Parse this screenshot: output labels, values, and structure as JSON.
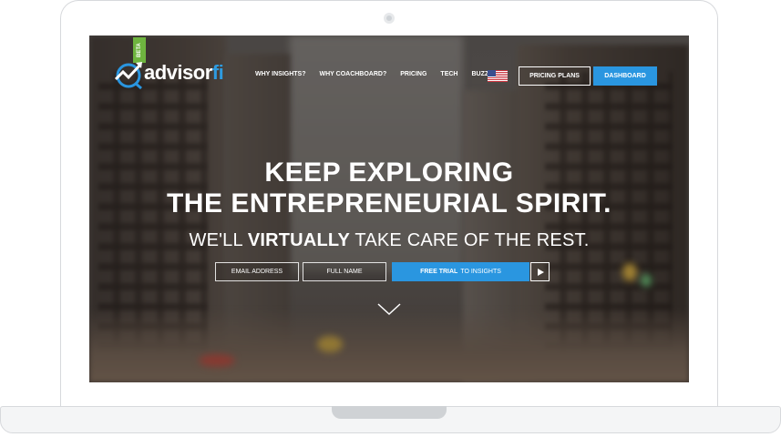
{
  "brand": {
    "name_main": "advisor",
    "name_accent": "fi",
    "badge": "BETA",
    "accent_color": "#2a96e0",
    "badge_color": "#6eb43f"
  },
  "nav": {
    "items": [
      "WHY INSIGHTS?",
      "WHY COACHBOARD?",
      "PRICING",
      "TECH",
      "BUZZ"
    ],
    "flag_icon": "us-flag-icon",
    "pricing_plans": "PRICING PLANS",
    "dashboard": "DASHBOARD"
  },
  "hero": {
    "title_line1": "KEEP EXPLORING",
    "title_line2": "THE ENTREPRENEURIAL SPIRIT.",
    "subtitle_prefix": "WE'LL ",
    "subtitle_bold": "VIRTUALLY",
    "subtitle_suffix": " TAKE CARE OF THE REST."
  },
  "signup": {
    "email_placeholder": "EMAIL ADDRESS",
    "name_placeholder": "FULL NAME",
    "cta_bold": "FREE TRIAL",
    "cta_rest": "TO INSIGHTS",
    "play_icon": "play-icon"
  },
  "scroll": {
    "icon": "chevron-down-icon"
  }
}
